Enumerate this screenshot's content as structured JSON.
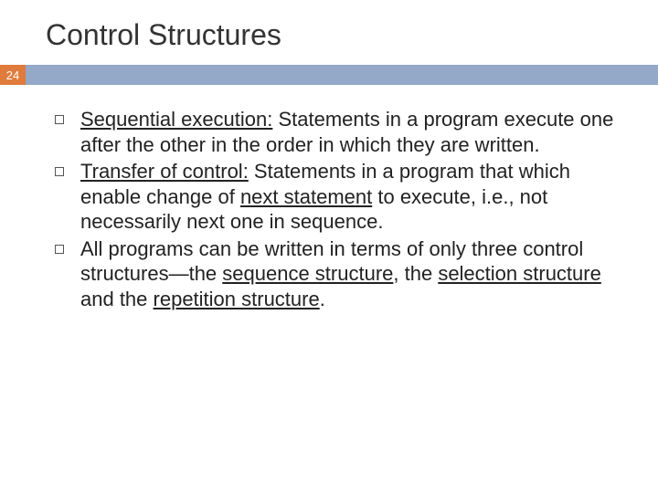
{
  "slide": {
    "title": "Control Structures",
    "pageNumber": "24",
    "bullets": [
      {
        "term": "Sequential execution:",
        "rest": " Statements in a program execute one after the other in the order in which they are written."
      },
      {
        "term": "Transfer of control:",
        "rest1": " Statements in a program that which enable change of ",
        "u1": "next statement",
        "rest2": " to execute, i.e., not necessarily next one in sequence."
      },
      {
        "rest1": "All programs can be written in terms of only three control structures—the ",
        "u1": "sequence structure",
        "mid1": ", the ",
        "u2": "selection structure",
        "mid2": " and the ",
        "u3": "repetition structure",
        "end": "."
      }
    ]
  }
}
